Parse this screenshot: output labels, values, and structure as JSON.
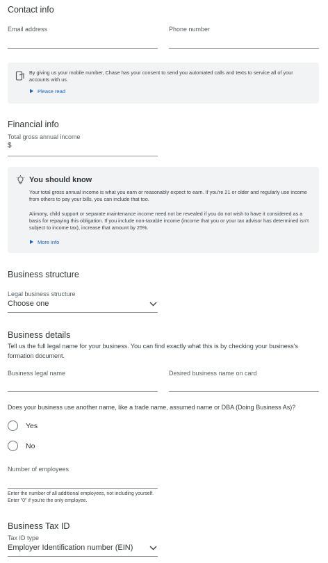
{
  "contact": {
    "title": "Contact info",
    "email_label": "Email address",
    "phone_label": "Phone number",
    "consent_text": "By giving us your mobile number, Chase has your consent to send you automated calls and texts to service all of your accounts with us.",
    "please_read": "Please read"
  },
  "financial": {
    "title": "Financial info",
    "income_label": "Total gross annual income",
    "income_prefix": "$",
    "know_title": "You should know",
    "know_p1": "Your total gross annual income is what you earn or reasonably expect to earn. If you're 21 or older and regularly use income from others to pay your bills, you can include that too.",
    "know_p2": "Alimony, child support or separate maintenance income need not be revealed if you do not wish to have it considered as a basis for repaying this obligation. If you include non-taxable income (income that you or your tax advisor has determined isn't subject to income tax), increase that amount by 25%.",
    "more_info": "More info"
  },
  "structure": {
    "title": "Business structure",
    "legal_label": "Legal business structure",
    "legal_value": "Choose one"
  },
  "details": {
    "title": "Business details",
    "description": "Tell us the full legal name for your business. You can find exactly what this is by checking your business's formation document.",
    "legal_name_label": "Business legal name",
    "card_name_label": "Desired business name on card",
    "dba_question": "Does your business use another name, like a trade name, assumed name or DBA (Doing Business As)?",
    "yes": "Yes",
    "no": "No",
    "employees_label": "Number of employees",
    "employees_hint": "Enter the number of all additional employees, not including yourself. Enter \"0\" if you're the only employee."
  },
  "tax": {
    "title": "Business Tax ID",
    "type_label": "Tax ID type",
    "type_value": "Employer Identification number (EIN)"
  }
}
